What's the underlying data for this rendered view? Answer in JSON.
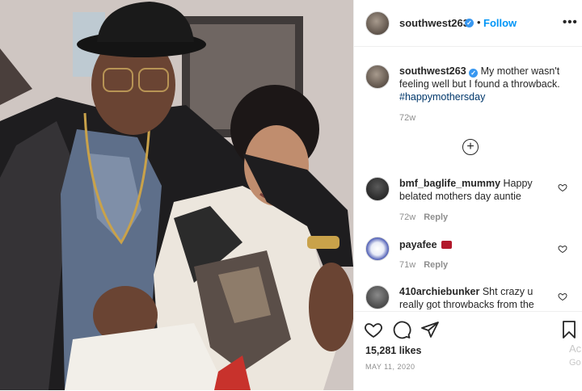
{
  "post": {
    "username": "southwest263",
    "verified_icon": "verified-badge-icon",
    "separator": "•",
    "follow_label": "Follow",
    "more_icon": "more-options-icon",
    "more_label": "•••",
    "caption_text": "My mother wasn't feeling well but I found a throwback.",
    "caption_hashtag": "#happymothersday",
    "caption_age": "72w",
    "load_more_icon": "plus-circle-icon",
    "load_more_label": "+"
  },
  "comments": [
    {
      "username": "bmf_baglife_mummy",
      "text": "Happy belated mothers day auntie",
      "age": "72w",
      "reply_label": "Reply"
    },
    {
      "username": "payafee",
      "text": "",
      "age": "71w",
      "reply_label": "Reply"
    },
    {
      "username": "410archiebunker",
      "text": "Sht crazy u really got throwbacks from the",
      "age": "",
      "reply_label": ""
    }
  ],
  "actions": {
    "like_icon": "heart-icon",
    "comment_icon": "comment-icon",
    "share_icon": "paper-plane-icon",
    "save_icon": "bookmark-icon",
    "likes_count": "15,281 likes",
    "date": "MAY 11, 2020"
  },
  "watermark": {
    "line1": "Ac",
    "line2": "Go"
  },
  "colors": {
    "accent": "#0095f6",
    "verified": "#3897f0",
    "text": "#262626",
    "muted": "#8e8e8e",
    "hashtag": "#00376b"
  }
}
